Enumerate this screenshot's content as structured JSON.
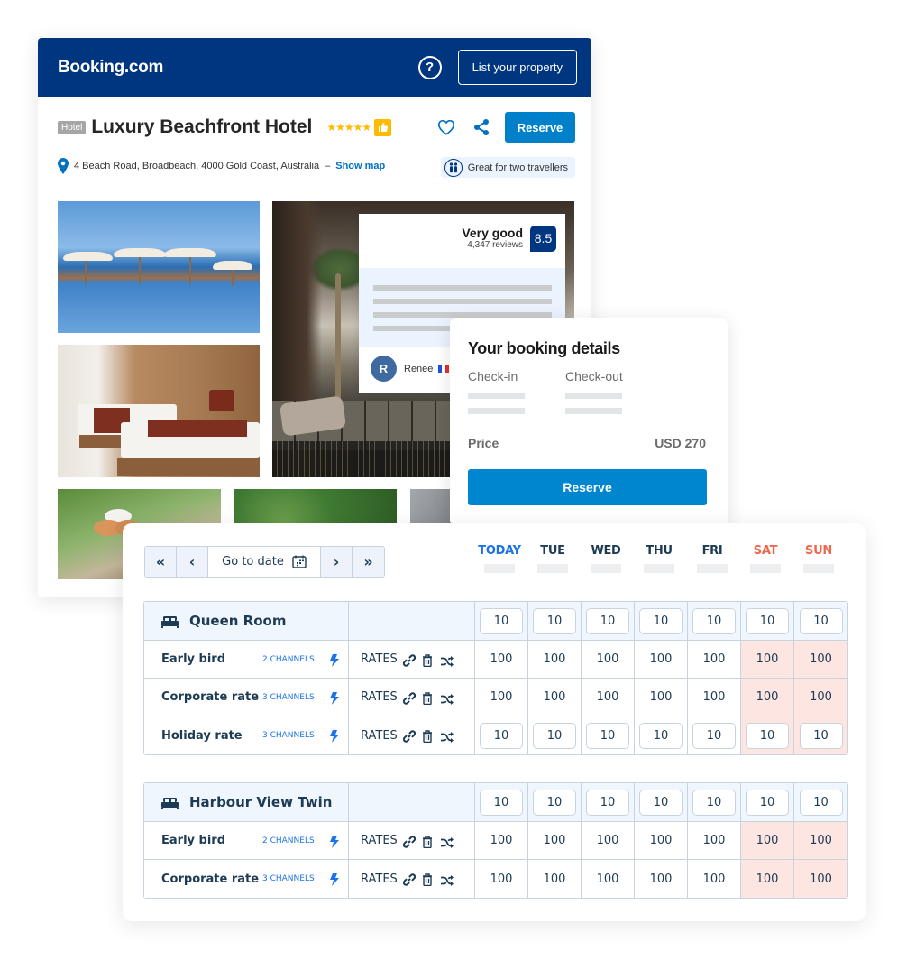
{
  "booking": {
    "header": {
      "logo": "Booking.com",
      "help_icon": "?",
      "list_property_label": "List your property"
    },
    "hotel": {
      "type_badge": "Hotel",
      "name": "Luxury Beachfront Hotel",
      "stars": "★★★★★",
      "star_rating": 5,
      "thumbs_icon": "👍",
      "reserve_label": "Reserve",
      "address": "4 Beach Road, Broadbeach, 4000 Gold Coast, Australia",
      "address_separator": "–",
      "show_map_label": "Show map",
      "highlight_label": "Great for two travellers"
    },
    "review": {
      "verdict": "Very good",
      "count": "4,347 reviews",
      "score": "8.5",
      "reviewer_initial": "R",
      "reviewer_name": "Renee"
    },
    "details": {
      "title": "Your booking details",
      "checkin_label": "Check-in",
      "checkout_label": "Check-out",
      "price_label": "Price",
      "price_value": "USD 270",
      "reserve_label": "Reserve"
    }
  },
  "channel_manager": {
    "nav": {
      "first_icon": "«",
      "prev_icon": "‹",
      "goto_label": "Go to date",
      "next_icon": "›",
      "last_icon": "»"
    },
    "days": [
      {
        "label": "TODAY",
        "color": "#1a73e8"
      },
      {
        "label": "TUE",
        "color": "#1d3b53"
      },
      {
        "label": "WED",
        "color": "#1d3b53"
      },
      {
        "label": "THU",
        "color": "#1d3b53"
      },
      {
        "label": "FRI",
        "color": "#1d3b53"
      },
      {
        "label": "SAT",
        "color": "#f0674b"
      },
      {
        "label": "SUN",
        "color": "#f0674b"
      }
    ],
    "rates_label": "RATES",
    "rooms": [
      {
        "name": "Queen Room",
        "availability": [
          "10",
          "10",
          "10",
          "10",
          "10",
          "10",
          "10"
        ],
        "rates": [
          {
            "name": "Early bird",
            "channels": "2 CHANNELS",
            "type": "value",
            "values": [
              "100",
              "100",
              "100",
              "100",
              "100",
              "100",
              "100"
            ]
          },
          {
            "name": "Corporate rate",
            "channels": "3 CHANNELS",
            "type": "value",
            "values": [
              "100",
              "100",
              "100",
              "100",
              "100",
              "100",
              "100"
            ]
          },
          {
            "name": "Holiday rate",
            "channels": "3 CHANNELS",
            "type": "input",
            "values": [
              "10",
              "10",
              "10",
              "10",
              "10",
              "10",
              "10"
            ]
          }
        ]
      },
      {
        "name": "Harbour View Twin",
        "availability": [
          "10",
          "10",
          "10",
          "10",
          "10",
          "10",
          "10"
        ],
        "rates": [
          {
            "name": "Early bird",
            "channels": "2 CHANNELS",
            "type": "value",
            "values": [
              "100",
              "100",
              "100",
              "100",
              "100",
              "100",
              "100"
            ]
          },
          {
            "name": "Corporate rate",
            "channels": "3 CHANNELS",
            "type": "value",
            "values": [
              "100",
              "100",
              "100",
              "100",
              "100",
              "100",
              "100"
            ]
          }
        ]
      }
    ]
  },
  "colors": {
    "booking_blue": "#003580",
    "reserve_blue": "#0080c9",
    "weekend_fill": "#fde5e1",
    "room_header_fill": "#f0f6fe"
  }
}
